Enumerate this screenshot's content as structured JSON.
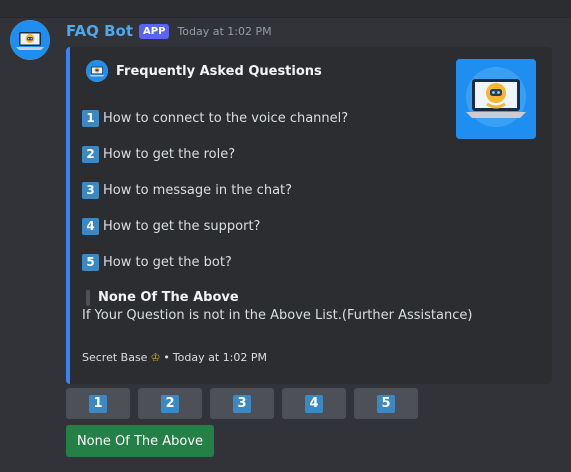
{
  "message": {
    "bot_name": "FAQ Bot",
    "badge": "APP",
    "timestamp": "Today at 1:02 PM",
    "avatar_icon": "robot-laptop-icon"
  },
  "embed": {
    "accent_color": "#3a82f6",
    "author": "Frequently Asked Questions",
    "thumbnail_icon": "robot-laptop-icon",
    "items": [
      {
        "number": "1",
        "text": "How to connect to the voice channel?"
      },
      {
        "number": "2",
        "text": "How to get the role?"
      },
      {
        "number": "3",
        "text": "How to message in the chat?"
      },
      {
        "number": "4",
        "text": "How to get the support?"
      },
      {
        "number": "5",
        "text": "How to get the bot?"
      }
    ],
    "field_name": "None Of The Above",
    "field_value": "If Your Question is not in the Above List.(Further Assistance)",
    "footer_server": "Secret Base",
    "footer_separator": "•",
    "footer_time": "Today at 1:02 PM"
  },
  "buttons": {
    "numbers": [
      "1",
      "2",
      "3",
      "4",
      "5"
    ],
    "none_label": "None Of The Above",
    "none_color": "#248046"
  }
}
